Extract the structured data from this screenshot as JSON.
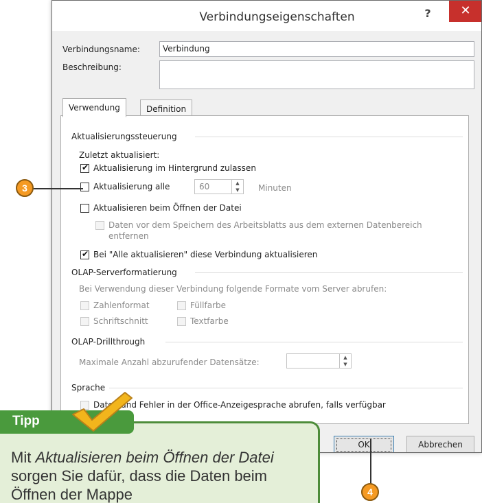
{
  "dialog": {
    "title": "Verbindungseigenschaften",
    "help_glyph": "?",
    "close_glyph": "✕",
    "name_label": "Verbindungsname:",
    "name_value": "Verbindung",
    "desc_label": "Beschreibung:",
    "desc_value": "",
    "tabs": [
      {
        "label": "Verwendung",
        "active": true
      },
      {
        "label": "Definition",
        "active": false
      }
    ],
    "refresh": {
      "title": "Aktualisierungssteuerung",
      "last_refreshed": "Zuletzt aktualisiert:",
      "background": {
        "label": "Aktualisierung im Hintergrund zulassen",
        "checked": true
      },
      "every": {
        "label": "Aktualisierung alle",
        "checked": false
      },
      "interval_value": "60",
      "interval_unit": "Minuten",
      "on_open": {
        "label": "Aktualisieren beim Öffnen der Datei",
        "checked": false
      },
      "remove_data": {
        "label": "Daten vor dem Speichern des Arbeitsblatts aus dem externen Datenbereich entfernen",
        "checked": false
      },
      "refresh_all": {
        "label": "Bei \"Alle aktualisieren\" diese Verbindung aktualisieren",
        "checked": true
      }
    },
    "olap_format": {
      "title": "OLAP-Serverformatierung",
      "hint": "Bei Verwendung dieser Verbindung folgende Formate vom Server abrufen:",
      "number_format": "Zahlenformat",
      "fill_color": "Füllfarbe",
      "font_style": "Schriftschnitt",
      "text_color": "Textfarbe"
    },
    "olap_drill": {
      "title": "OLAP-Drillthrough",
      "max_records": "Maximale Anzahl abzurufender Datensätze:",
      "max_value": ""
    },
    "language": {
      "title": "Sprache",
      "option": "Daten und Fehler in der Office-Anzeigesprache abrufen, falls verfügbar"
    },
    "ok_label": "OK",
    "cancel_label": "Abbrechen"
  },
  "callouts": {
    "three": "3",
    "four": "4"
  },
  "tip": {
    "label": "Tipp",
    "text_prefix": "Mit ",
    "text_em": "Aktualisieren beim Öffnen der Datei",
    "text_suffix": " sorgen Sie dafür, dass die Daten beim Öffnen der Mappe"
  },
  "colors": {
    "close": "#c7302c",
    "callout": "#f59a23",
    "tip_header": "#4a9a3d",
    "tip_bg": "#e4efd8"
  }
}
